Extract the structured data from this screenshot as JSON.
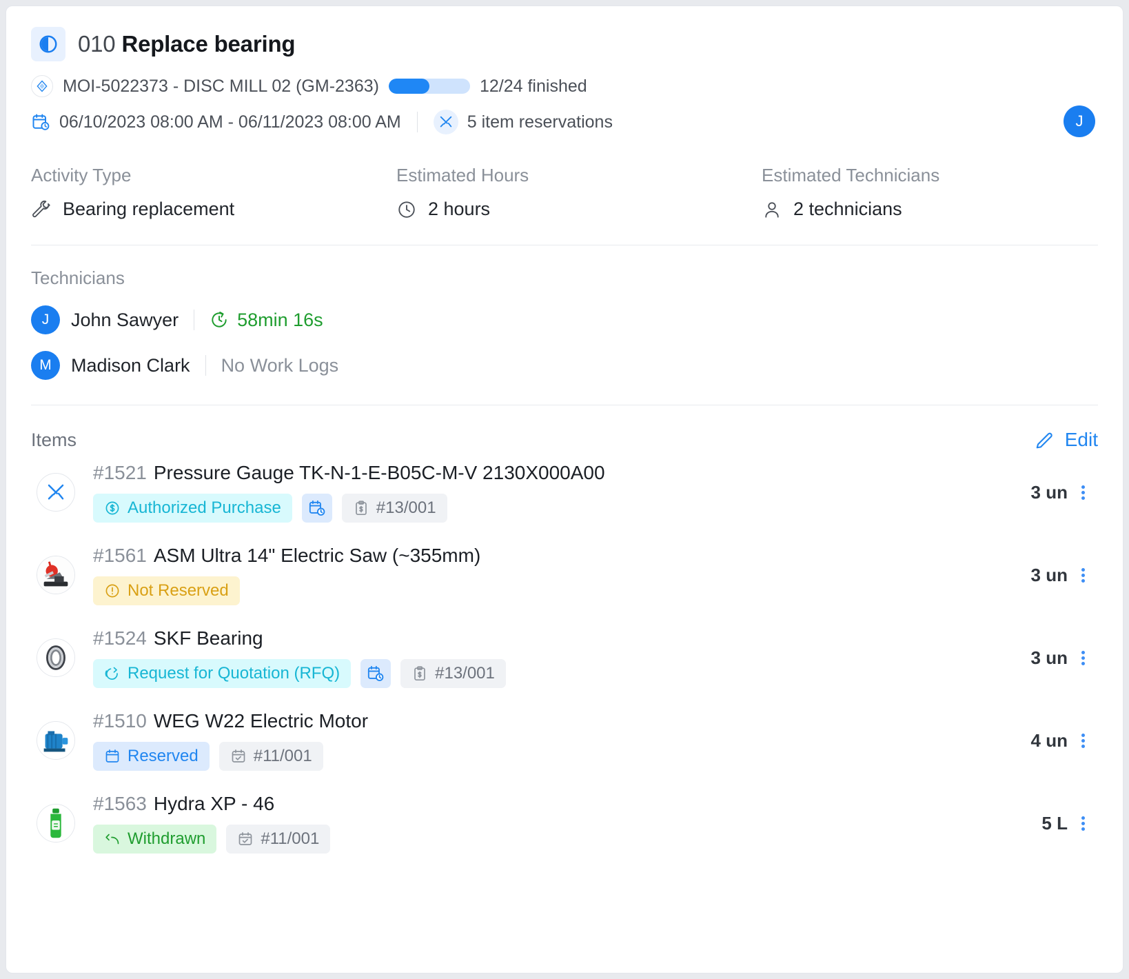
{
  "header": {
    "order_number": "010",
    "title": "Replace bearing",
    "asset": "MOI-5022373 - DISC MILL 02 (GM-2363)",
    "progress_label": "12/24 finished",
    "progress_done": 12,
    "progress_total": 24,
    "date_range": "06/10/2023 08:00 AM - 06/11/2023 08:00 AM",
    "reservations": "5 item reservations",
    "avatar_initial": "J",
    "accent_color": "#1f87f5"
  },
  "fields": [
    {
      "label": "Activity Type",
      "value": "Bearing replacement",
      "icon": "wrench-icon"
    },
    {
      "label": "Estimated Hours",
      "value": "2 hours",
      "icon": "clock-icon"
    },
    {
      "label": "Estimated Technicians",
      "value": "2 technicians",
      "icon": "person-icon"
    }
  ],
  "technicians": {
    "section_label": "Technicians",
    "list": [
      {
        "initial": "J",
        "name": "John Sawyer",
        "log": "58min 16s",
        "log_state": "logged"
      },
      {
        "initial": "M",
        "name": "Madison Clark",
        "log": "No Work Logs",
        "log_state": "empty"
      }
    ]
  },
  "items_section": {
    "title": "Items",
    "edit_label": "Edit",
    "items": [
      {
        "id": "#1521",
        "name": "Pressure Gauge TK-N-1-E-B05C-M-V 2130X000A00",
        "thumb": "tools-icon",
        "quantity": "3 un",
        "badges": [
          {
            "type": "cyan",
            "icon": "dollar-circle-icon",
            "label": "Authorized Purchase"
          },
          {
            "type": "iconbox",
            "icon": "calendar-clock-icon",
            "label": ""
          },
          {
            "type": "grey",
            "icon": "clipboard-dollar-icon",
            "label": "#13/001"
          }
        ]
      },
      {
        "id": "#1561",
        "name": "ASM Ultra 14\" Electric Saw (~355mm)",
        "thumb": "saw-photo",
        "quantity": "3 un",
        "badges": [
          {
            "type": "amber",
            "icon": "alert-circle-icon",
            "label": "Not Reserved"
          }
        ]
      },
      {
        "id": "#1524",
        "name": "SKF Bearing",
        "thumb": "bearing-photo",
        "quantity": "3 un",
        "badges": [
          {
            "type": "cyan",
            "icon": "rfq-icon",
            "label": "Request for Quotation (RFQ)"
          },
          {
            "type": "iconbox",
            "icon": "calendar-clock-icon",
            "label": ""
          },
          {
            "type": "grey",
            "icon": "clipboard-dollar-icon",
            "label": "#13/001"
          }
        ]
      },
      {
        "id": "#1510",
        "name": "WEG W22 Electric Motor",
        "thumb": "motor-photo",
        "quantity": "4 un",
        "badges": [
          {
            "type": "blue",
            "icon": "calendar-icon",
            "label": "Reserved"
          },
          {
            "type": "grey",
            "icon": "calendar-check-icon",
            "label": "#11/001"
          }
        ]
      },
      {
        "id": "#1563",
        "name": "Hydra XP - 46",
        "thumb": "oil-bottle-photo",
        "quantity": "5 L",
        "badges": [
          {
            "type": "green",
            "icon": "withdraw-arrow-icon",
            "label": "Withdrawn"
          },
          {
            "type": "grey",
            "icon": "calendar-check-icon",
            "label": "#11/001"
          }
        ]
      }
    ]
  }
}
